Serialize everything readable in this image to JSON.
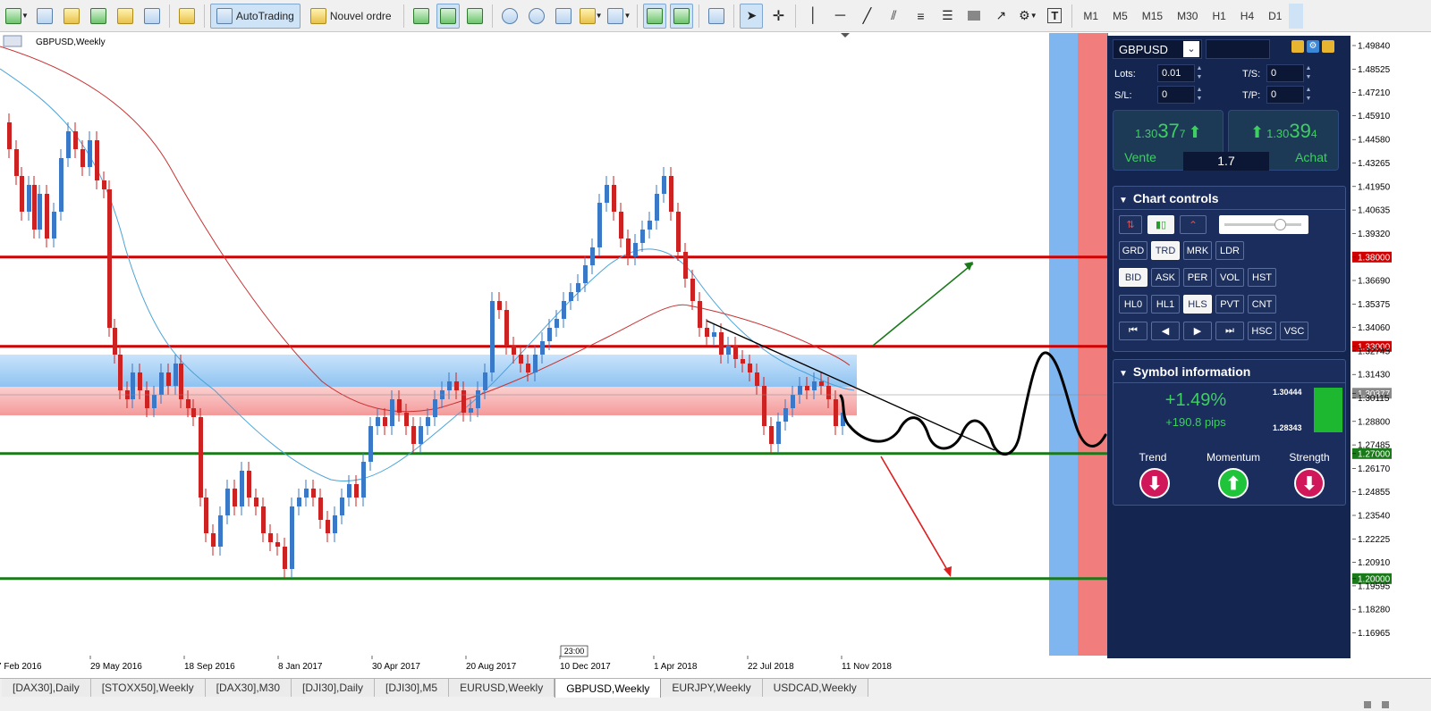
{
  "toolbar": {
    "autotrading": "AutoTrading",
    "new_order": "Nouvel ordre",
    "timeframes": [
      "M1",
      "M5",
      "M15",
      "M30",
      "H1",
      "H4",
      "D1"
    ]
  },
  "chart": {
    "title": "GBPUSD,Weekly",
    "x_labels": [
      "7 Feb 2016",
      "29 May 2016",
      "18 Sep 2016",
      "8 Jan 2017",
      "30 Apr 2017",
      "20 Aug 2017",
      "10 Dec 2017",
      "1 Apr 2018",
      "22 Jul 2018",
      "11 Nov 2018"
    ],
    "y_ticks": [
      "1.49840",
      "1.48525",
      "1.47210",
      "1.45910",
      "1.44580",
      "1.43265",
      "1.41950",
      "1.40635",
      "1.39320",
      "1.38000",
      "1.36690",
      "1.35375",
      "1.34060",
      "1.33000",
      "1.32745",
      "1.31430",
      "1.30377",
      "1.30115",
      "1.28800",
      "1.27485",
      "1.27000",
      "1.26170",
      "1.24855",
      "1.23540",
      "1.22225",
      "1.20910",
      "1.20000",
      "1.19595",
      "1.18280",
      "1.16965"
    ],
    "time_label": "23:00",
    "levels": [
      {
        "price": "1.38000",
        "color": "#d00000"
      },
      {
        "price": "1.33000",
        "color": "#d00000"
      },
      {
        "price": "1.27000",
        "color": "#1a7a1a"
      },
      {
        "price": "1.20000",
        "color": "#1a7a1a"
      }
    ],
    "current_price": "1.30377",
    "series_colors": {
      "bull": "#3a78c8",
      "bear": "#cc2222",
      "ma_fast": "#4aa3d8",
      "ma_slow": "#c83232"
    },
    "chart_data": {
      "type": "candlestick",
      "title": "GBPUSD,Weekly",
      "ylim": [
        1.165,
        1.505
      ],
      "x_ticks": [
        "7 Feb 2016",
        "29 May 2016",
        "18 Sep 2016",
        "8 Jan 2017",
        "30 Apr 2017",
        "20 Aug 2017",
        "10 Dec 2017",
        "1 Apr 2018",
        "22 Jul 2018",
        "11 Nov 2018"
      ],
      "horizontal_levels": [
        1.38,
        1.33,
        1.27,
        1.2
      ],
      "zone": [
        1.292,
        1.324
      ],
      "current_price": 1.30377
    }
  },
  "panel": {
    "symbol": "GBPUSD",
    "lots_label": "Lots:",
    "lots": "0.01",
    "ts_label": "T/S:",
    "ts": "0",
    "sl_label": "S/L:",
    "sl": "0",
    "tp_label": "T/P:",
    "tp": "0",
    "sell_price_prefix": "1.30",
    "sell_price_big": "37",
    "sell_price_small": "7",
    "buy_price_prefix": "1.30",
    "buy_price_big": "39",
    "buy_price_small": "4",
    "sell_label": "Vente",
    "buy_label": "Achat",
    "spread": "1.7",
    "chart_controls_title": "Chart controls",
    "buttons_row1": [
      "GRD",
      "TRD",
      "MRK",
      "LDR"
    ],
    "buttons_row2": [
      "BID",
      "ASK",
      "PER",
      "VOL",
      "HST"
    ],
    "buttons_row3": [
      "HL0",
      "HL1",
      "HLS",
      "PVT",
      "CNT"
    ],
    "buttons_row4": [
      "⏮",
      "◀",
      "▶",
      "⏭",
      "HSC",
      "VSC"
    ],
    "symbol_info_title": "Symbol information",
    "change_pct": "+1.49%",
    "change_pips": "+190.8 pips",
    "high": "1.30444",
    "low": "1.28343",
    "trend_label": "Trend",
    "momentum_label": "Momentum",
    "strength_label": "Strength"
  },
  "tabs": [
    "[DAX30],Daily",
    "[STOXX50],Weekly",
    "[DAX30],M30",
    "[DJI30],Daily",
    "[DJI30],M5",
    "EURUSD,Weekly",
    "GBPUSD,Weekly",
    "EURJPY,Weekly",
    "USDCAD,Weekly"
  ],
  "active_tab": "GBPUSD,Weekly"
}
